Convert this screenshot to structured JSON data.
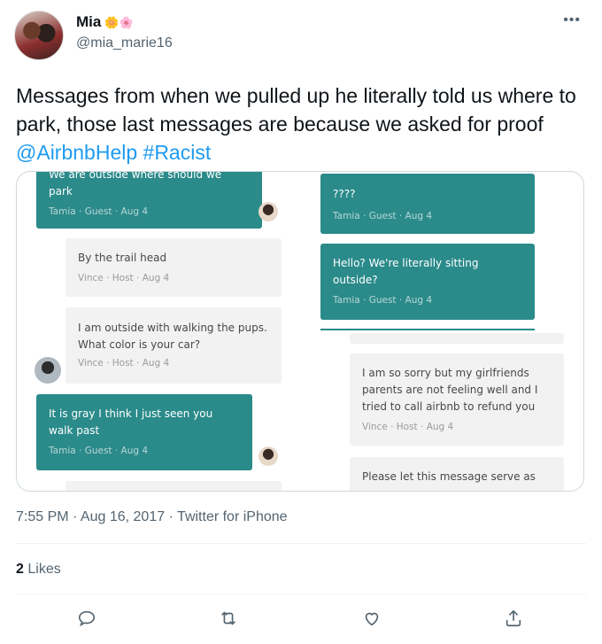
{
  "author": {
    "name": "Mia",
    "name_emoji": "🌼🌸",
    "handle": "@mia_marie16"
  },
  "tweet": {
    "text": "Messages from when we pulled up he literally told us where to park, those last messages are because we asked for proof ",
    "mention": "@AirbnbHelp",
    "hashtag": "#Racist",
    "timestamp": "7:55 PM · Aug 16, 2017 · Twitter for iPhone",
    "likes_count": "2",
    "likes_label": "Likes"
  },
  "screenshot": {
    "left_messages": [
      {
        "text": "We are outside where should we park",
        "meta": "Tamia · Guest · Aug 4"
      },
      {
        "text": "By the trail head",
        "meta": "Vince · Host · Aug 4"
      },
      {
        "text": "I am outside with walking the pups. What color is your car?",
        "meta": "Vince · Host · Aug 4"
      },
      {
        "text": "It is gray I think I just seen you walk past",
        "meta": "Tamia · Guest · Aug 4"
      }
    ],
    "right_messages": [
      {
        "text": "????",
        "meta": "Tamia · Guest · Aug 4"
      },
      {
        "text": "Hello? We're literally sitting outside?",
        "meta": "Tamia · Guest · Aug 4"
      },
      {
        "text": "I am so sorry but my girlfriends parents are not feeling well and I tried to call airbnb to refund you",
        "meta": "Vince · Host · Aug 4"
      },
      {
        "text": "Please let this message serve as",
        "meta": ""
      }
    ]
  },
  "icons": [
    "more-icon",
    "reply-icon",
    "retweet-icon",
    "like-icon",
    "share-icon"
  ],
  "colors": {
    "link": "#1d9bf0",
    "guest_bubble": "#2b8a8a",
    "host_bubble": "#f2f2f2"
  }
}
